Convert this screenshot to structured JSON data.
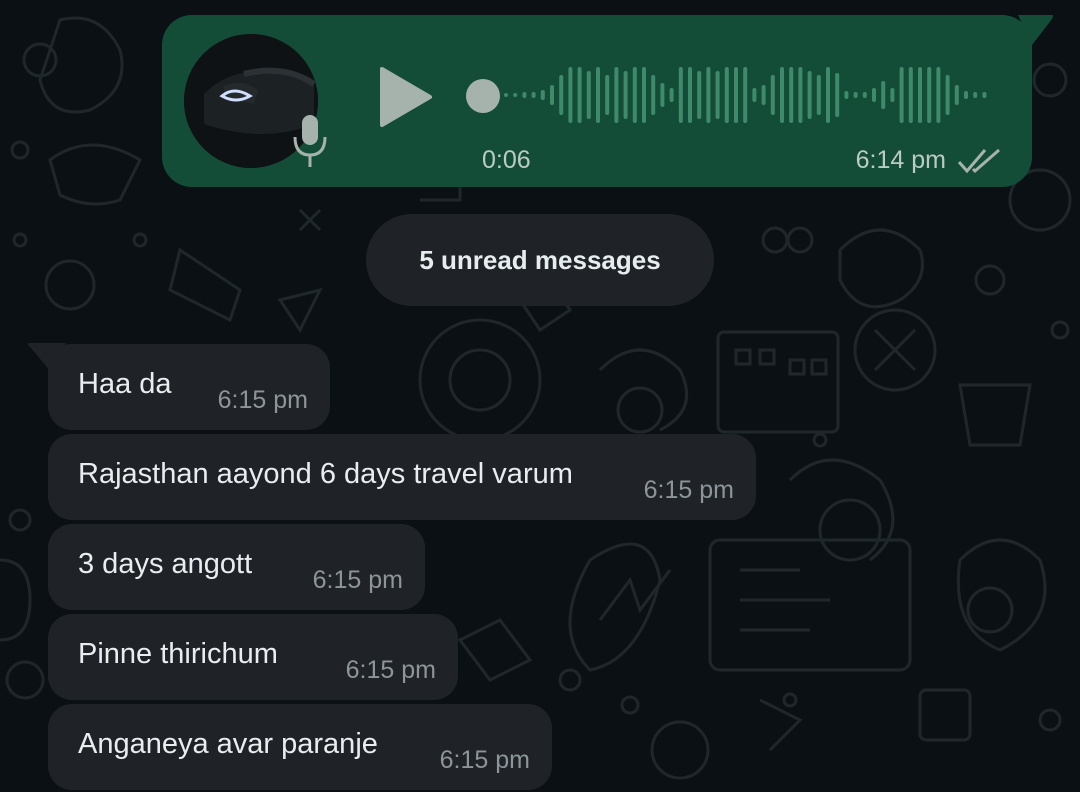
{
  "voice_message": {
    "duration": "0:06",
    "time": "6:14 pm",
    "status": "read",
    "icons": [
      "play-icon",
      "mic-icon",
      "double-check-icon"
    ]
  },
  "unread_banner": "5 unread messages",
  "messages": [
    {
      "text": "Haa da",
      "time": "6:15 pm"
    },
    {
      "text": "Rajasthan aayond 6 days travel varum",
      "time": "6:15 pm"
    },
    {
      "text": "3 days angott",
      "time": "6:15 pm"
    },
    {
      "text": "Pinne thirichum",
      "time": "6:15 pm"
    },
    {
      "text": "Anganeya avar paranje",
      "time": "6:15 pm"
    }
  ],
  "colors": {
    "background": "#0b1014",
    "outgoing_bubble": "#144d37",
    "incoming_bubble": "#1f2327",
    "text": "#e9edef",
    "timestamp": "#8c9599"
  }
}
